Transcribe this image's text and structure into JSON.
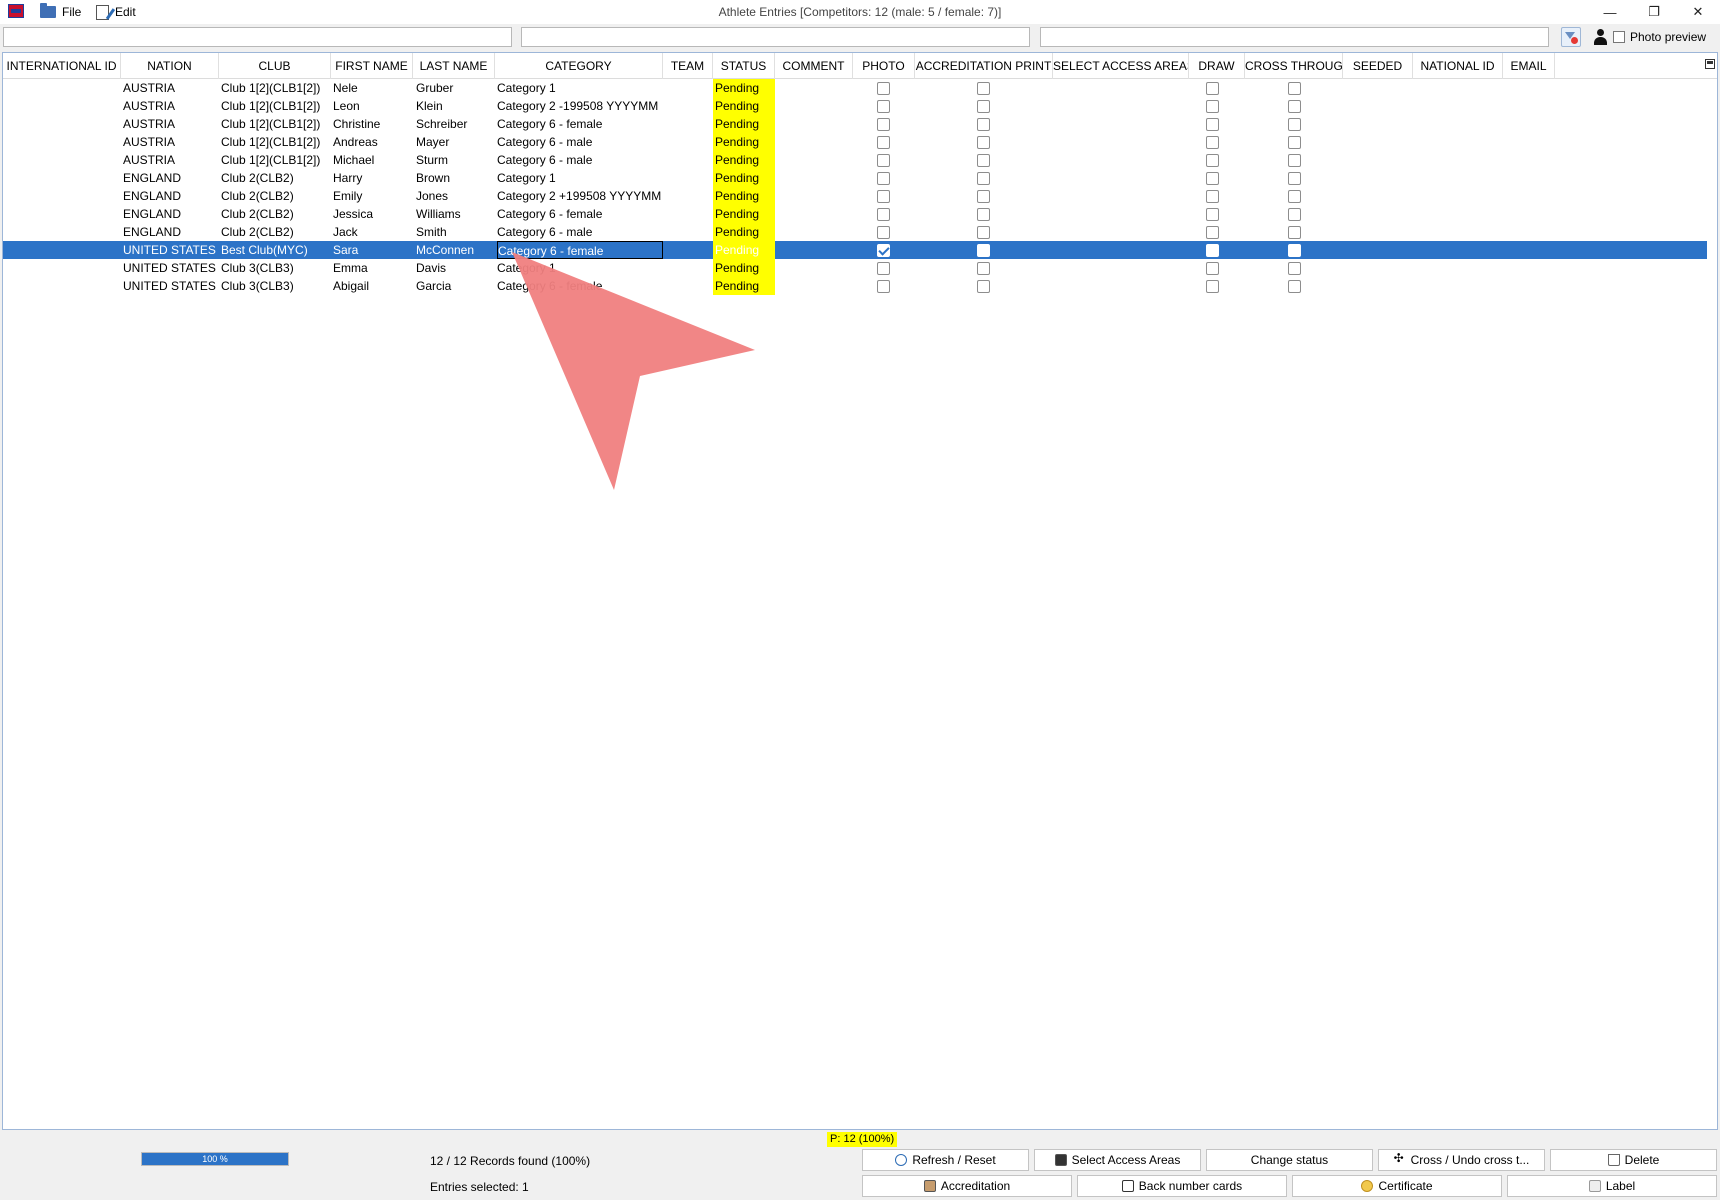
{
  "window": {
    "title": "Athlete Entries [Competitors: 12 (male: 5 / female: 7)]",
    "minimize": "—",
    "restore": "❐",
    "close": "✕"
  },
  "menu": {
    "file": "File",
    "edit": "Edit"
  },
  "toolbar": {
    "photo_preview_label": "Photo preview",
    "photo_preview_checked": false
  },
  "grid": {
    "columns": [
      "INTERNATIONAL ID",
      "NATION",
      "CLUB",
      "FIRST NAME",
      "LAST NAME",
      "CATEGORY",
      "TEAM",
      "STATUS",
      "COMMENT",
      "PHOTO",
      "ACCREDITATION PRINT",
      "SELECT ACCESS AREAS",
      "DRAW",
      "CROSS THROUGH",
      "SEEDED",
      "NATIONAL ID",
      "EMAIL"
    ],
    "selected_row_index": 9,
    "rows": [
      {
        "nation": "AUSTRIA",
        "club": "Club 1[2](CLB1[2])",
        "first": "Nele",
        "last": "Gruber",
        "category": "Category 1",
        "status": "Pending",
        "photo": false
      },
      {
        "nation": "AUSTRIA",
        "club": "Club 1[2](CLB1[2])",
        "first": "Leon",
        "last": "Klein",
        "category": "Category 2 -199508 YYYYMM",
        "status": "Pending",
        "photo": false
      },
      {
        "nation": "AUSTRIA",
        "club": "Club 1[2](CLB1[2])",
        "first": "Christine",
        "last": "Schreiber",
        "category": "Category 6 - female",
        "status": "Pending",
        "photo": false
      },
      {
        "nation": "AUSTRIA",
        "club": "Club 1[2](CLB1[2])",
        "first": "Andreas",
        "last": "Mayer",
        "category": "Category 6 - male",
        "status": "Pending",
        "photo": false
      },
      {
        "nation": "AUSTRIA",
        "club": "Club 1[2](CLB1[2])",
        "first": "Michael",
        "last": "Sturm",
        "category": "Category 6 - male",
        "status": "Pending",
        "photo": false
      },
      {
        "nation": "ENGLAND",
        "club": "Club 2(CLB2)",
        "first": "Harry",
        "last": "Brown",
        "category": "Category 1",
        "status": "Pending",
        "photo": false
      },
      {
        "nation": "ENGLAND",
        "club": "Club 2(CLB2)",
        "first": "Emily",
        "last": "Jones",
        "category": "Category 2 +199508 YYYYMM",
        "status": "Pending",
        "photo": false
      },
      {
        "nation": "ENGLAND",
        "club": "Club 2(CLB2)",
        "first": "Jessica",
        "last": "Williams",
        "category": "Category 6 - female",
        "status": "Pending",
        "photo": false
      },
      {
        "nation": "ENGLAND",
        "club": "Club 2(CLB2)",
        "first": "Jack",
        "last": "Smith",
        "category": "Category 6 - male",
        "status": "Pending",
        "photo": false
      },
      {
        "nation": "UNITED STATES",
        "club": "Best Club(MYC)",
        "first": "Sara",
        "last": "McConnen",
        "category": "Category 6 - female",
        "status": "Pending",
        "photo": true
      },
      {
        "nation": "UNITED STATES",
        "club": "Club 3(CLB3)",
        "first": "Emma",
        "last": "Davis",
        "category": "Category 1",
        "status": "Pending",
        "photo": false
      },
      {
        "nation": "UNITED STATES",
        "club": "Club 3(CLB3)",
        "first": "Abigail",
        "last": "Garcia",
        "category": "Category 6 - female",
        "status": "Pending",
        "photo": false
      }
    ]
  },
  "colors": {
    "status_highlight": "#ffff00",
    "selection": "#2c73c7",
    "cursor_overlay": "#f08080"
  },
  "footer": {
    "summary_badge": "P: 12 (100%)",
    "progress_percent": 100,
    "progress_label": "100 %",
    "records_found": "12 / 12 Records found (100%)",
    "entries_selected": "Entries selected: 1"
  },
  "buttons": {
    "refresh": "Refresh / Reset",
    "select_access": "Select Access Areas",
    "change_status": "Change status",
    "cross": "Cross / Undo cross t...",
    "delete": "Delete",
    "accreditation": "Accreditation",
    "back_number": "Back number cards",
    "certificate": "Certificate",
    "label": "Label"
  }
}
